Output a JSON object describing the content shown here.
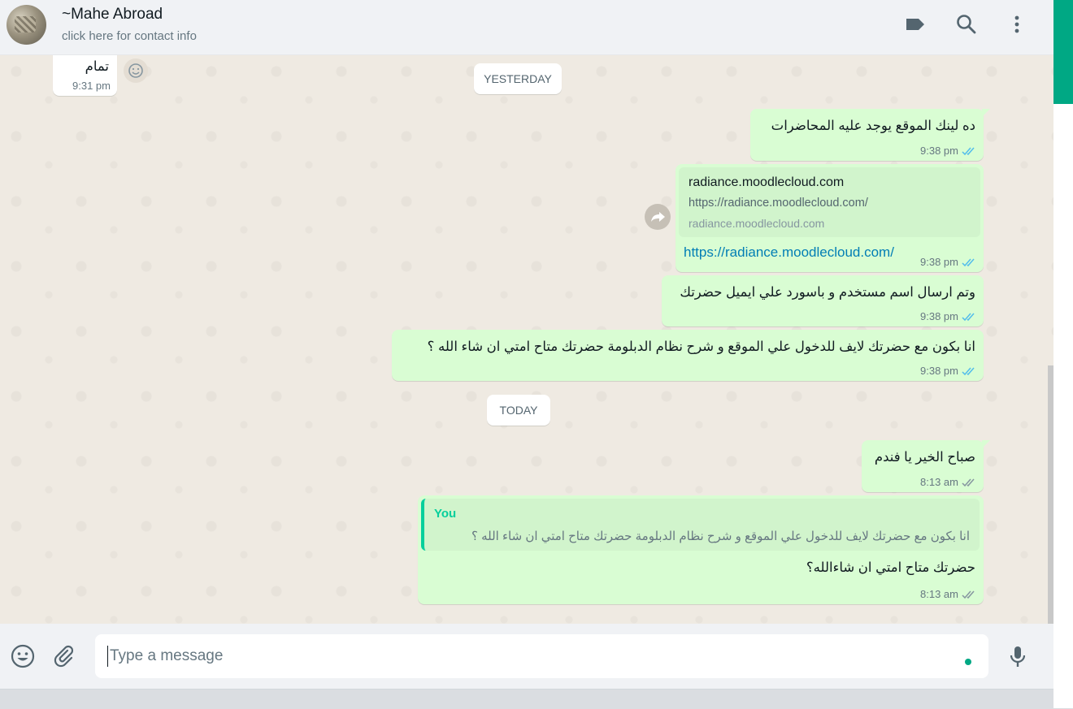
{
  "header": {
    "contact_name": "~Mahe Abroad",
    "contact_subtitle": "click here for contact info",
    "icons": [
      "label-icon",
      "search-icon",
      "menu-dots-icon"
    ]
  },
  "chat": {
    "day_yesterday": "YESTERDAY",
    "day_today": "TODAY",
    "incoming_prev": {
      "text": "تمام",
      "time": "9:31 pm"
    },
    "messages": [
      {
        "text": "ده لينك الموقع يوجد عليه المحاضرات",
        "time": "9:38 pm",
        "status": "read"
      },
      {
        "preview_title": "radiance.moodlecloud.com",
        "preview_url": "https://radiance.moodlecloud.com/",
        "preview_host": "radiance.moodlecloud.com",
        "link": "https://radiance.moodlecloud.com/",
        "time": "9:38 pm",
        "status": "read"
      },
      {
        "text": "وتم ارسال اسم مستخدم و باسورد علي ايميل حضرتك",
        "time": "9:38 pm",
        "status": "read"
      },
      {
        "text": "انا بكون مع حضرتك لايف للدخول علي الموقع و شرح نظام الدبلومة حضرتك متاح امتي ان شاء الله ؟",
        "time": "9:38 pm",
        "status": "read"
      },
      {
        "text": "صباح الخير يا فندم",
        "time": "8:13 am",
        "status": "delivered"
      },
      {
        "quote_author": "You",
        "quote_text": "انا بكون مع حضرتك لايف للدخول علي الموقع و شرح نظام الدبلومة حضرتك متاح امتي ان شاء الله ؟",
        "text": "حضرتك متاح امتي ان شاءالله؟",
        "time": "8:13 am",
        "status": "delivered"
      }
    ]
  },
  "composer": {
    "placeholder": "Type a message",
    "icons": [
      "emoji-icon",
      "attach-icon",
      "mic-icon"
    ]
  },
  "colors": {
    "outgoing_bubble": "#d9fdd3",
    "incoming_bubble": "#ffffff",
    "read_ticks": "#53bdeb",
    "delivered_ticks": "#8696a0",
    "accent": "#00a884"
  }
}
